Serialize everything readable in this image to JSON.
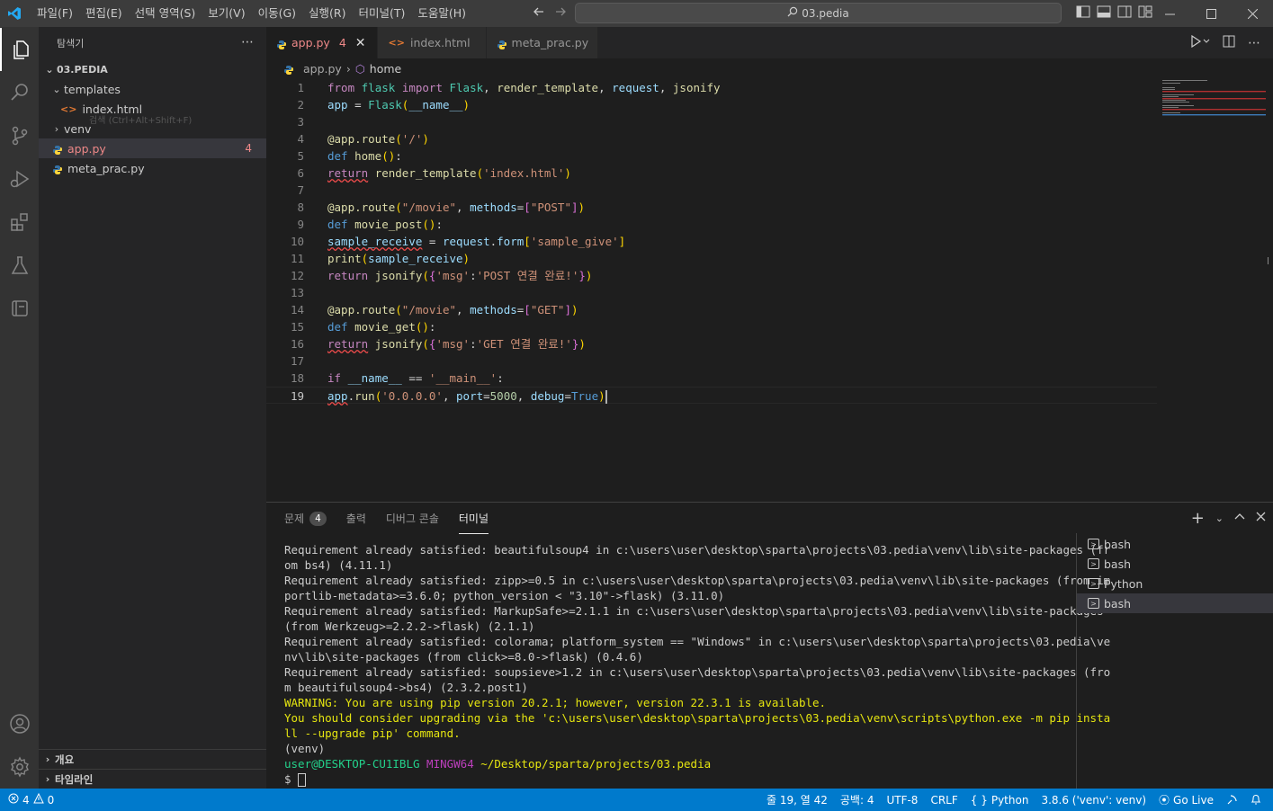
{
  "menu": [
    "파일(F)",
    "편집(E)",
    "선택 영역(S)",
    "보기(V)",
    "이동(G)",
    "실행(R)",
    "터미널(T)",
    "도움말(H)"
  ],
  "command_center": "03.pedia",
  "explorer": {
    "title": "탐색기",
    "folder": "03.PEDIA",
    "ghost_hint": "검색 (Ctrl+Alt+Shift+F)",
    "items": [
      {
        "label": "templates"
      },
      {
        "label": "index.html"
      },
      {
        "label": "venv"
      },
      {
        "label": "app.py",
        "count": "4"
      },
      {
        "label": "meta_prac.py"
      }
    ],
    "outline": "개요",
    "timeline": "타임라인"
  },
  "tabs": [
    {
      "label": "app.py",
      "count": "4"
    },
    {
      "label": "index.html"
    },
    {
      "label": "meta_prac.py"
    }
  ],
  "breadcrumb": {
    "file": "app.py",
    "symbol": "home"
  },
  "line_numbers": [
    "1",
    "2",
    "3",
    "4",
    "5",
    "6",
    "7",
    "8",
    "9",
    "10",
    "11",
    "12",
    "13",
    "14",
    "15",
    "16",
    "17",
    "18",
    "19"
  ],
  "panel": {
    "tabs": [
      {
        "label": "문제",
        "count": "4"
      },
      {
        "label": "출력"
      },
      {
        "label": "디버그 콘솔"
      },
      {
        "label": "터미널"
      }
    ],
    "terminal_lines": [
      "Requirement already satisfied: beautifulsoup4 in c:\\users\\user\\desktop\\sparta\\projects\\03.pedia\\venv\\lib\\site-packages (fr",
      "om bs4) (4.11.1)",
      "Requirement already satisfied: zipp>=0.5 in c:\\users\\user\\desktop\\sparta\\projects\\03.pedia\\venv\\lib\\site-packages (from im",
      "portlib-metadata>=3.6.0; python_version < \"3.10\"->flask) (3.11.0)",
      "Requirement already satisfied: MarkupSafe>=2.1.1 in c:\\users\\user\\desktop\\sparta\\projects\\03.pedia\\venv\\lib\\site-packages",
      "(from Werkzeug>=2.2.2->flask) (2.1.1)",
      "Requirement already satisfied: colorama; platform_system == \"Windows\" in c:\\users\\user\\desktop\\sparta\\projects\\03.pedia\\ve",
      "nv\\lib\\site-packages (from click>=8.0->flask) (0.4.6)",
      "Requirement already satisfied: soupsieve>1.2 in c:\\users\\user\\desktop\\sparta\\projects\\03.pedia\\venv\\lib\\site-packages (fro",
      "m beautifulsoup4->bs4) (2.3.2.post1)"
    ],
    "warning_lines": [
      "WARNING: You are using pip version 20.2.1; however, version 22.3.1 is available.",
      "You should consider upgrading via the 'c:\\users\\user\\desktop\\sparta\\projects\\03.pedia\\venv\\scripts\\python.exe -m pip insta",
      "ll --upgrade pip' command."
    ],
    "venv_line": "(venv)",
    "prompt": {
      "user": "user@DESKTOP-CU1IBLG",
      "sys": "MINGW64",
      "path": "~/Desktop/sparta/projects/03.pedia",
      "dollar": "$ "
    },
    "terminals": [
      "bash",
      "bash",
      "Python",
      "bash"
    ]
  },
  "status": {
    "errors": "4",
    "warnings": "0",
    "position": "줄 19, 열 42",
    "spaces": "공백: 4",
    "encoding": "UTF-8",
    "eol": "CRLF",
    "language": "Python",
    "interpreter": "3.8.6 ('venv': venv)",
    "golive": "Go Live"
  },
  "colors": {
    "accent": "#007acc",
    "error": "#f14c4c",
    "activity_bar": "#333333",
    "sidebar": "#252526",
    "editor": "#1e1e1e"
  }
}
